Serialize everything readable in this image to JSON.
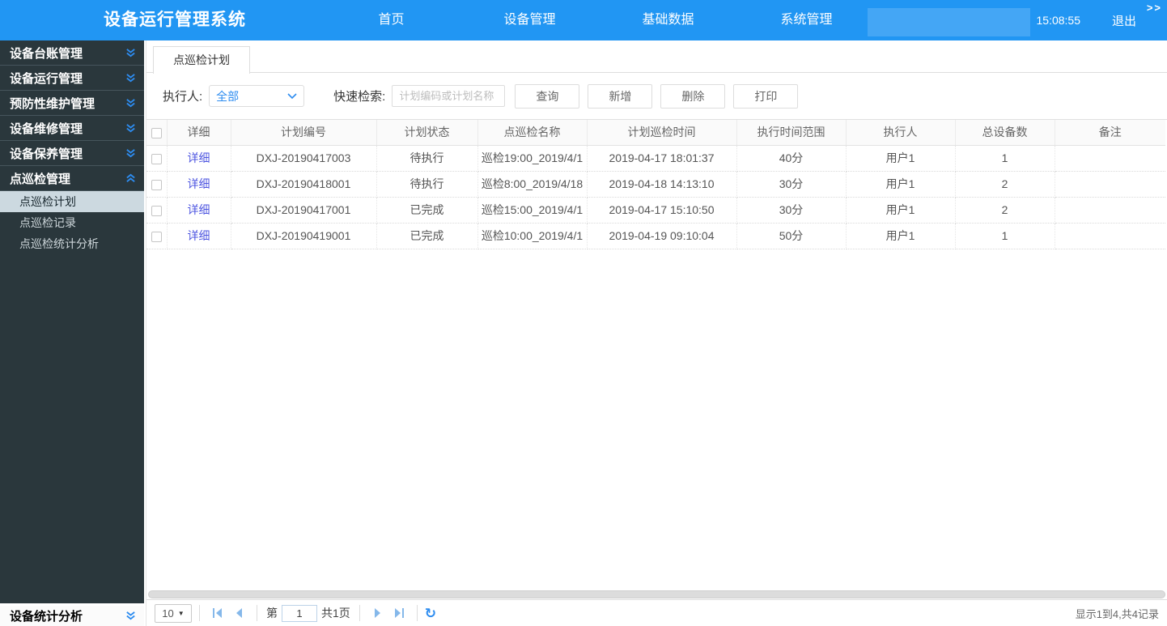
{
  "header": {
    "title": "设备运行管理系统",
    "nav": [
      {
        "label": "首页"
      },
      {
        "label": "设备管理"
      },
      {
        "label": "基础数据"
      },
      {
        "label": "系统管理"
      }
    ],
    "time": "15:08:55",
    "logout_label": "退出",
    "collapse_label": ">>"
  },
  "sidebar": {
    "items": [
      {
        "label": "设备台账管理",
        "state": "collapsed"
      },
      {
        "label": "设备运行管理",
        "state": "collapsed"
      },
      {
        "label": "预防性维护管理",
        "state": "collapsed"
      },
      {
        "label": "设备维修管理",
        "state": "collapsed"
      },
      {
        "label": "设备保养管理",
        "state": "collapsed"
      },
      {
        "label": "点巡检管理",
        "state": "expanded",
        "children": [
          {
            "label": "点巡检计划",
            "selected": true
          },
          {
            "label": "点巡检记录",
            "selected": false
          },
          {
            "label": "点巡检统计分析",
            "selected": false
          }
        ]
      },
      {
        "label": "设备统计分析",
        "state": "collapsed"
      }
    ]
  },
  "main": {
    "tab_label": "点巡检计划",
    "filters": {
      "executor_label": "执行人:",
      "executor_value": "全部",
      "search_label": "快速检索:",
      "search_placeholder": "计划编码或计划名称"
    },
    "buttons": {
      "query": "查询",
      "add": "新增",
      "delete": "删除",
      "print": "打印"
    },
    "table": {
      "detail_label": "详细",
      "columns": [
        "详细",
        "计划编号",
        "计划状态",
        "点巡检名称",
        "计划巡检时间",
        "执行时间范围",
        "执行人",
        "总设备数",
        "备注"
      ],
      "rows": [
        {
          "plan_no": "DXJ-20190417003",
          "status": "待执行",
          "name": "巡检19:00_2019/4/1",
          "time": "2019-04-17 18:01:37",
          "range": "40分",
          "executor": "用户1",
          "device_count": "1",
          "remark": ""
        },
        {
          "plan_no": "DXJ-20190418001",
          "status": "待执行",
          "name": "巡检8:00_2019/4/18",
          "time": "2019-04-18 14:13:10",
          "range": "30分",
          "executor": "用户1",
          "device_count": "2",
          "remark": ""
        },
        {
          "plan_no": "DXJ-20190417001",
          "status": "已完成",
          "name": "巡检15:00_2019/4/1",
          "time": "2019-04-17 15:10:50",
          "range": "30分",
          "executor": "用户1",
          "device_count": "2",
          "remark": ""
        },
        {
          "plan_no": "DXJ-20190419001",
          "status": "已完成",
          "name": "巡检10:00_2019/4/1",
          "time": "2019-04-19 09:10:04",
          "range": "50分",
          "executor": "用户1",
          "device_count": "1",
          "remark": ""
        }
      ]
    },
    "pagination": {
      "page_size": "10",
      "page_prefix": "第",
      "current_page": "1",
      "total_pages_label": "共1页",
      "summary": "显示1到4,共4记录"
    }
  },
  "icons": {
    "chevron_double_down": "double-chevron-down",
    "chevron_double_up": "double-chevron-up",
    "dropdown_caret": "▼",
    "refresh": "↻"
  },
  "colors": {
    "header_bg": "#2196f3",
    "sidebar_bg": "#2a373c",
    "accent_blue": "#2d8cf0",
    "link_blue": "#4d55e0",
    "selected_menu_bg": "#ccd9e0",
    "pager_icon_blue": "#85b8ea"
  }
}
